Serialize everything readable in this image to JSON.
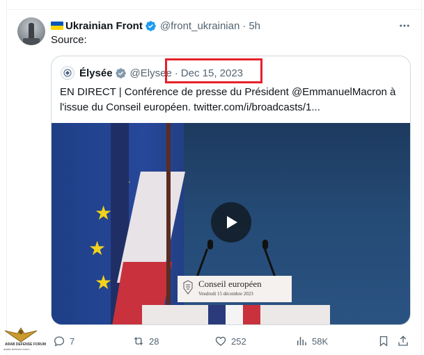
{
  "tweet": {
    "author_name": "Ukrainian Front",
    "author_handle": "@front_ukrainian",
    "separator": "·",
    "time": "5h",
    "text": "Source:"
  },
  "quote": {
    "author_name": "Élysée",
    "author_handle": "@Elysee",
    "separator": "·",
    "date": "Dec 15, 2023",
    "text": "EN DIRECT | Conférence de presse du Président @EmmanuelMacron à l'issue du Conseil européen. twitter.com/i/broadcasts/1..."
  },
  "media": {
    "sign_title": "Conseil européen",
    "sign_subtitle": "Vendredi 15 décembre 2023"
  },
  "actions": {
    "replies": "7",
    "reposts": "28",
    "likes": "252",
    "views": "58K"
  },
  "watermark": {
    "line1": "ARAB DEFENSE FORUM",
    "line2": "arabic.defence.forum"
  },
  "colors": {
    "secondary_text": "#536471",
    "verified_blue": "#1d9bf0",
    "verified_gray": "#829aab",
    "highlight_red": "#e5202a"
  },
  "icons": {
    "verified": "verified-badge-icon",
    "more": "more-horizontal-icon",
    "reply": "reply-icon",
    "repost": "repost-icon",
    "like": "heart-icon",
    "views": "bar-chart-icon",
    "bookmark": "bookmark-icon",
    "share": "share-icon",
    "play": "play-icon"
  }
}
